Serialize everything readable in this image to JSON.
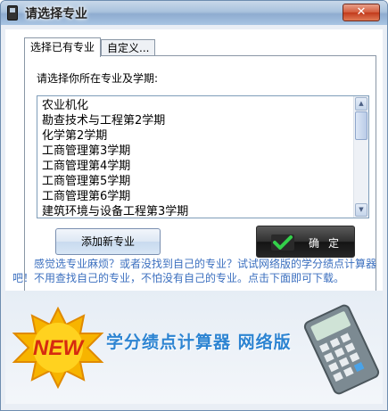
{
  "window": {
    "title": "请选择专业",
    "close_label": "✕"
  },
  "tabs": [
    {
      "label": "选择已有专业",
      "active": true
    },
    {
      "label": "自定义...",
      "active": false
    }
  ],
  "panel": {
    "prompt": "请选择你所在专业及学期:",
    "list_items": [
      "农业机化",
      "勘查技术与工程第2学期",
      "化学第2学期",
      "工商管理第3学期",
      "工商管理第4学期",
      "工商管理第5学期",
      "工商管理第6学期",
      "建筑环境与设备工程第3学期"
    ],
    "add_button": "添加新专业",
    "ok_button": "确定"
  },
  "promo": {
    "text": "感觉选专业麻烦？或者没找到自己的专业？试试网络版的学分绩点计算器吧！不用查找自己的专业，不怕没有自己的专业。点击下面即可下载。"
  },
  "banner": {
    "badge": "NEW",
    "title": "学分绩点计算器 网络版"
  },
  "colors": {
    "accent": "#2d84d2",
    "promo_text": "#3b6fbf",
    "badge": "#f0a000"
  }
}
